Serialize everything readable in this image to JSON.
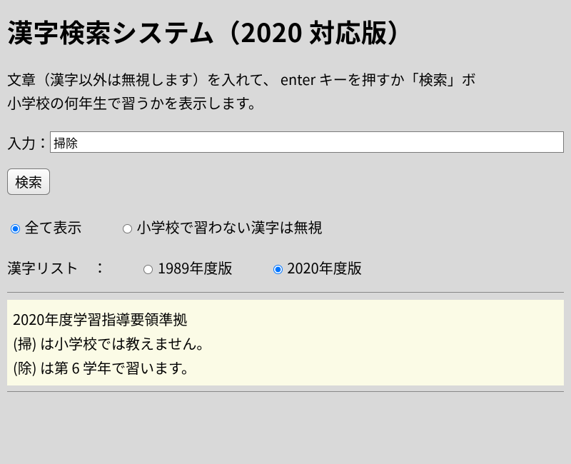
{
  "title": "漢字検索システム（2020 対応版）",
  "description_line1": "文章（漢字以外は無視します）を入れて、 enter キーを押すか「検索」ボ",
  "description_line2": "小学校の何年生で習うかを表示します。",
  "input_label": "入力：",
  "input_value": "掃除",
  "search_button": "検索",
  "display_filter": {
    "all": "全て表示",
    "ignore": "小学校で習わない漢字は無視",
    "selected": "all"
  },
  "list_label": "漢字リスト　：",
  "list_version": {
    "v1989": "1989年度版",
    "v2020": "2020年度版",
    "selected": "v2020"
  },
  "result": {
    "header": "2020年度学習指導要領準拠",
    "lines": [
      "(掃) は小学校では教えません。",
      "(除) は第 6 学年で習います。"
    ]
  }
}
